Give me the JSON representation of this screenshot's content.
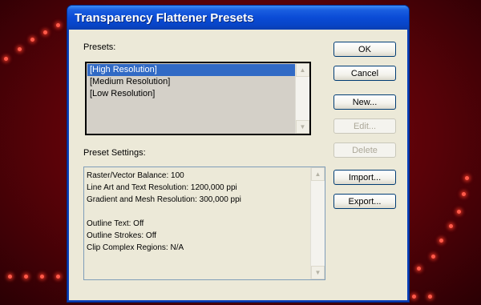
{
  "window": {
    "title": "Transparency Flattener Presets"
  },
  "presets": {
    "label": "Presets:",
    "items": [
      "[High Resolution]",
      "[Medium Resolution]",
      "[Low Resolution]"
    ],
    "selected_index": 0
  },
  "preset_settings": {
    "label": "Preset Settings:",
    "lines": [
      "Raster/Vector Balance: 100",
      "Line Art and Text Resolution: 1200,000 ppi",
      "Gradient and Mesh Resolution: 300,000 ppi",
      "",
      "Outline Text: Off",
      "Outline Strokes: Off",
      "Clip Complex Regions: N/A"
    ]
  },
  "buttons": {
    "ok": "OK",
    "cancel": "Cancel",
    "new": "New...",
    "edit": "Edit...",
    "delete": "Delete",
    "import": "Import...",
    "export": "Export..."
  },
  "colors": {
    "title_bar": "#0a4bd6",
    "selection": "#316ac5",
    "dialog_face": "#ece9d8",
    "background": "#5a0208"
  }
}
